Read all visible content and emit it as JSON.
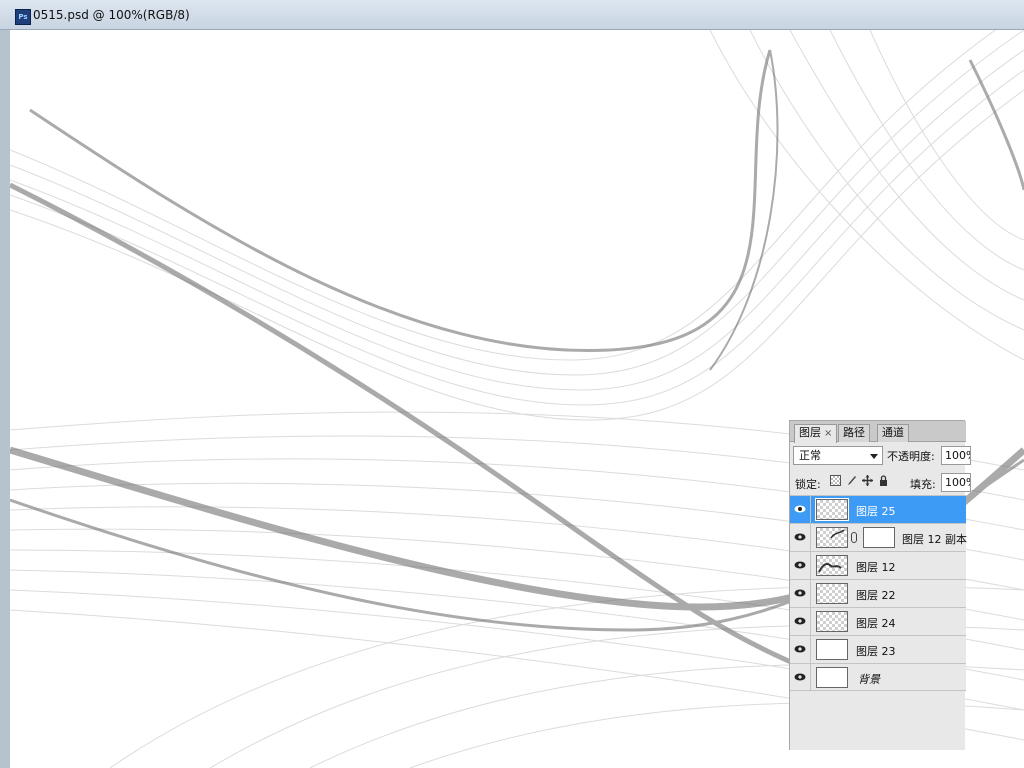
{
  "window": {
    "title": "0515.psd @ 100%(RGB/8)",
    "app_icon": "ps-icon"
  },
  "layers_panel": {
    "tabs": [
      {
        "label": "图层",
        "active": true,
        "close": "×"
      },
      {
        "label": "路径",
        "active": false
      },
      {
        "label": "通道",
        "active": false
      }
    ],
    "blend_mode": "正常",
    "opacity_label": "不透明度:",
    "opacity_value": "100%",
    "lock_label": "锁定:",
    "fill_label": "填充:",
    "fill_value": "100%",
    "layers": [
      {
        "name": "图层 25",
        "selected": true,
        "thumb": "transparent",
        "has_mask": false
      },
      {
        "name": "图层 12 副本",
        "selected": false,
        "thumb": "transparent",
        "has_mask": true
      },
      {
        "name": "图层 12",
        "selected": false,
        "thumb": "transparent",
        "has_mask": false
      },
      {
        "name": "图层 22",
        "selected": false,
        "thumb": "transparent",
        "has_mask": false
      },
      {
        "name": "图层 24",
        "selected": false,
        "thumb": "transparent",
        "has_mask": false
      },
      {
        "name": "图层 23",
        "selected": false,
        "thumb": "white",
        "has_mask": false
      },
      {
        "name": "背景",
        "selected": false,
        "thumb": "white",
        "has_mask": false,
        "italic": true
      }
    ]
  },
  "colors": {
    "selection": "#3d9bf5",
    "panel_bg": "#e8e8e8"
  }
}
